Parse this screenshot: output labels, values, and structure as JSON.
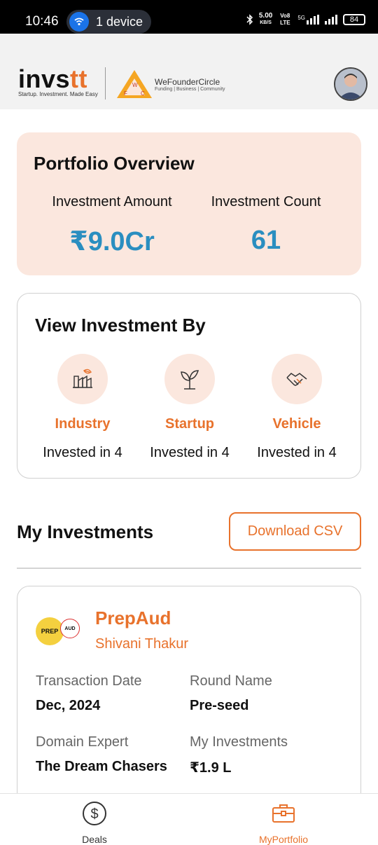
{
  "status_bar": {
    "time": "10:46",
    "pill_text": "1 device",
    "net_speed_value": "5.00",
    "net_speed_unit": "KB/S",
    "volte": "Vo8 LTE",
    "network": "5G",
    "battery": "84"
  },
  "header": {
    "brand_main": "invs",
    "brand_accent": "tt",
    "brand_tagline": "Startup. Investment. Made Easy",
    "partner_name": "WeFounderCircle",
    "partner_tagline": "Funding | Business | Community",
    "partner_letters": [
      "W",
      "F",
      "C"
    ]
  },
  "overview": {
    "title": "Portfolio Overview",
    "amount_label": "Investment Amount",
    "amount_value": "₹9.0Cr",
    "count_label": "Investment Count",
    "count_value": "61"
  },
  "view_by": {
    "title": "View Investment By",
    "items": [
      {
        "label": "Industry",
        "sub": "Invested in 4",
        "icon": "industry-icon"
      },
      {
        "label": "Startup",
        "sub": "Invested in 4",
        "icon": "sprout-icon"
      },
      {
        "label": "Vehicle",
        "sub": "Invested in 4",
        "icon": "handshake-icon"
      }
    ]
  },
  "my_investments": {
    "title": "My Investments",
    "download_label": "Download CSV",
    "cards": [
      {
        "logo_text_1": "PREP",
        "logo_text_2": "AUD",
        "name": "PrepAud",
        "owner": "Shivani Thakur",
        "transaction_date_label": "Transaction Date",
        "transaction_date": "Dec, 2024",
        "round_label": "Round Name",
        "round": "Pre-seed",
        "expert_label": "Domain Expert",
        "expert": "The Dream Chasers",
        "my_inv_label": "My Investments",
        "my_inv": "₹1.9 L"
      }
    ]
  },
  "bottom_nav": {
    "items": [
      {
        "label": "Deals",
        "active": false
      },
      {
        "label": "MyPortfolio",
        "active": true
      }
    ]
  },
  "colors": {
    "accent": "#e8722c",
    "value_blue": "#2a8ec0",
    "card_peach": "#fbe7de"
  }
}
